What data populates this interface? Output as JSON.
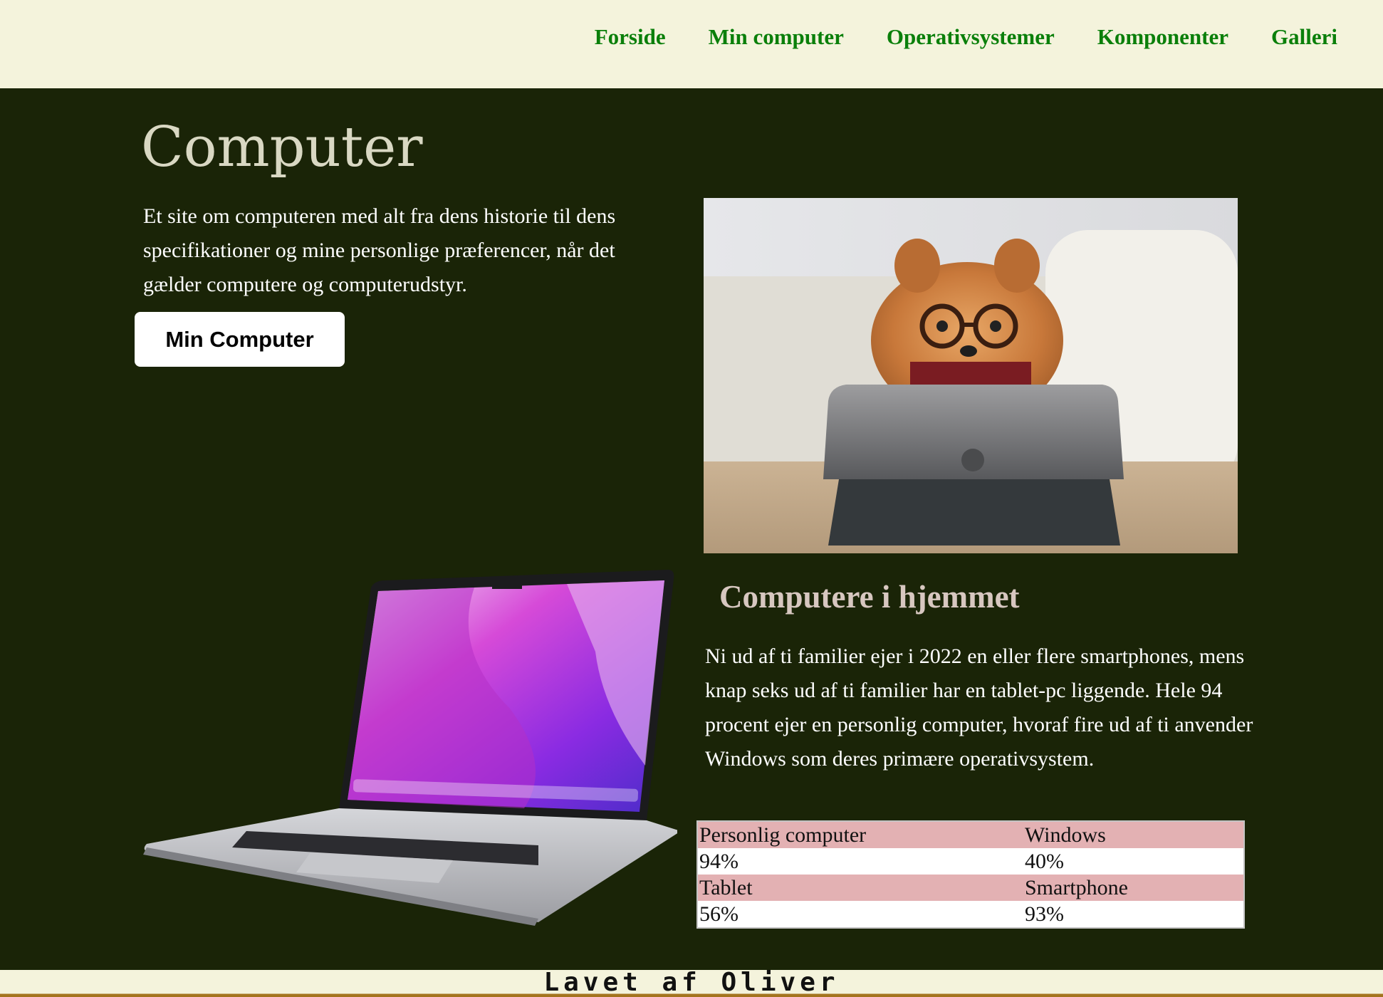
{
  "nav": {
    "items": [
      {
        "label": "Forside"
      },
      {
        "label": "Min computer"
      },
      {
        "label": "Operativsystemer"
      },
      {
        "label": "Komponenter"
      },
      {
        "label": "Galleri"
      }
    ]
  },
  "hero": {
    "title": "Computer",
    "text": "Et site om computeren med alt fra dens historie til dens specifikationer og mine personlige præferencer, når det gælder computere og computerudstyr.",
    "button_label": "Min Computer"
  },
  "section": {
    "title": "Computere i hjemmet",
    "text": "Ni ud af ti familier ejer i 2022 en eller flere smartphones, mens knap seks ud af ti familier har en tablet-pc liggende. Hele 94 procent ejer en personlig computer, hvoraf fire ud af ti anvender Windows som deres primære operativsystem."
  },
  "stats": {
    "rows": [
      [
        "Personlig computer",
        "Windows"
      ],
      [
        "94%",
        "40%"
      ],
      [
        "Tablet",
        "Smartphone"
      ],
      [
        "56%",
        "93%"
      ]
    ]
  },
  "footer": {
    "text": "Lavet af Oliver"
  },
  "colors": {
    "header_bg": "#f4f3dc",
    "nav_link": "#0a7f0a",
    "page_bg": "#1a2407",
    "table_header": "#e3b1b3"
  }
}
